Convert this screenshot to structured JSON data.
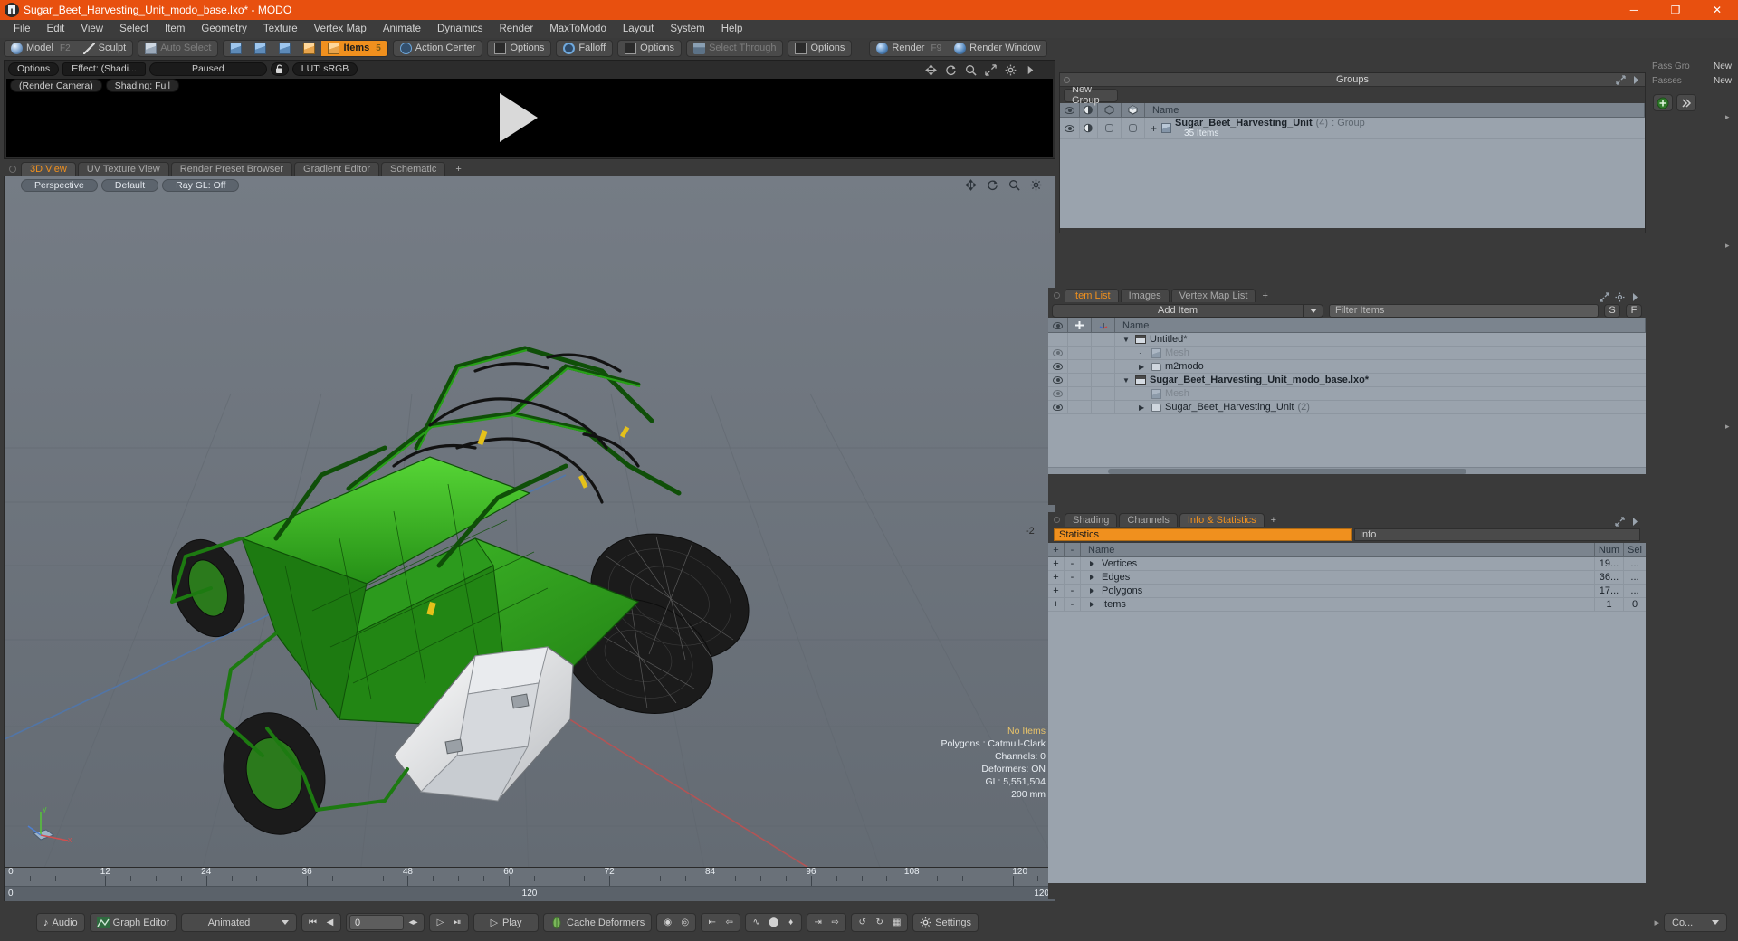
{
  "window": {
    "title": "Sugar_Beet_Harvesting_Unit_modo_base.lxo* - MODO",
    "minimize": "─",
    "maximize": "❐",
    "close": "✕"
  },
  "menubar": [
    "File",
    "Edit",
    "View",
    "Select",
    "Item",
    "Geometry",
    "Texture",
    "Vertex Map",
    "Animate",
    "Dynamics",
    "Render",
    "MaxToModo",
    "Layout",
    "System",
    "Help"
  ],
  "modebar": {
    "model": "Model",
    "model_key": "F2",
    "sculpt": "Sculpt",
    "auto_select": "Auto Select",
    "items": "Items",
    "items_key": "5",
    "action_center": "Action Center",
    "options1": "Options",
    "falloff": "Falloff",
    "options2": "Options",
    "select_through": "Select Through",
    "options3": "Options",
    "render": "Render",
    "render_key": "F9",
    "render_window": "Render Window"
  },
  "render_panel": {
    "options": "Options",
    "effect": "Effect: (Shadi...",
    "paused": "Paused",
    "lut": "LUT: sRGB",
    "render_camera": "(Render Camera)",
    "shading": "Shading: Full"
  },
  "viewport": {
    "tabs": [
      "3D View",
      "UV Texture View",
      "Render Preset Browser",
      "Gradient Editor",
      "Schematic"
    ],
    "active_tab": "3D View",
    "add_tab": "+",
    "projection": "Perspective",
    "shading_style": "Default",
    "raygl": "Ray GL: Off",
    "stats": {
      "no_items": "No Items",
      "polygons": "Polygons : Catmull-Clark",
      "channels": "Channels: 0",
      "deformers": "Deformers: ON",
      "gl": "GL: 5,551,504",
      "scale": "200 mm"
    },
    "axis": {
      "x": "x",
      "y": "y",
      "z": "z"
    },
    "depth_label": "-2"
  },
  "timeline": {
    "ticks": [
      {
        "label": "0",
        "pos": 0
      },
      {
        "label": "12",
        "pos": 9.6
      },
      {
        "label": "24",
        "pos": 19.2
      },
      {
        "label": "36",
        "pos": 28.8
      },
      {
        "label": "48",
        "pos": 38.4
      },
      {
        "label": "60",
        "pos": 48.0
      },
      {
        "label": "72",
        "pos": 57.6
      },
      {
        "label": "84",
        "pos": 67.2
      },
      {
        "label": "96",
        "pos": 76.8
      },
      {
        "label": "108",
        "pos": 86.4
      },
      {
        "label": "120",
        "pos": 96.0
      }
    ],
    "start": "0",
    "center": "120",
    "end": "120"
  },
  "groups_panel": {
    "title": "Groups",
    "new_group": "New Group",
    "columns": [
      "Name"
    ],
    "rows": [
      {
        "name": "Sugar_Beet_Harvesting_Unit",
        "count": "(4)",
        "type": ": Group",
        "sub": "35 Items",
        "expander": "+"
      }
    ]
  },
  "item_list_panel": {
    "tabs": [
      "Item List",
      "Images",
      "Vertex Map List"
    ],
    "active_tab": "Item List",
    "add_tab": "+",
    "add_item": "Add Item",
    "filter_placeholder": "Filter Items",
    "filter_value": "",
    "btn_s": "S",
    "btn_f": "F",
    "columns": [
      "Name"
    ],
    "rows": [
      {
        "name": "Untitled*",
        "indent": 0,
        "icon": "clapper-icon",
        "bold": false,
        "dim": false,
        "expander": "down"
      },
      {
        "name": "Mesh",
        "indent": 1,
        "icon": "mesh-icon",
        "bold": false,
        "dim": true,
        "expander": "dot"
      },
      {
        "name": "m2modo",
        "indent": 1,
        "icon": "folder-icon",
        "bold": false,
        "dim": false,
        "expander": "right"
      },
      {
        "name": "Sugar_Beet_Harvesting_Unit_modo_base.lxo*",
        "indent": 0,
        "icon": "clapper-icon",
        "bold": true,
        "dim": false,
        "expander": "down"
      },
      {
        "name": "Mesh",
        "indent": 1,
        "icon": "mesh-icon",
        "bold": false,
        "dim": true,
        "expander": "dot"
      },
      {
        "name": "Sugar_Beet_Harvesting_Unit",
        "count": "(2)",
        "indent": 1,
        "icon": "folder-icon",
        "bold": false,
        "dim": false,
        "expander": "right"
      }
    ]
  },
  "info_panel": {
    "tabs": [
      "Shading",
      "Channels",
      "Info & Statistics"
    ],
    "active_tab": "Info & Statistics",
    "add_tab": "+",
    "statistics_label": "Statistics",
    "info_label": "Info",
    "columns": {
      "plus": "+",
      "minus": "-",
      "name": "Name",
      "num": "Num",
      "sel": "Sel"
    },
    "rows": [
      {
        "plus": "+",
        "minus": "-",
        "name": "Vertices",
        "num": "19...",
        "sel": "..."
      },
      {
        "plus": "+",
        "minus": "-",
        "name": "Edges",
        "num": "36...",
        "sel": "..."
      },
      {
        "plus": "+",
        "minus": "-",
        "name": "Polygons",
        "num": "17...",
        "sel": "..."
      },
      {
        "plus": "+",
        "minus": "-",
        "name": "Items",
        "num": "1",
        "sel": "0"
      }
    ]
  },
  "rail": {
    "pass_group_label": "Pass Gro",
    "pass_group_new": "New",
    "passes_label": "Passes",
    "passes_new": "New",
    "co_label": "Co..."
  },
  "bottombar": {
    "audio": "Audio",
    "graph_editor": "Graph Editor",
    "animated": "Animated",
    "frame_value": "0",
    "play": "Play",
    "cache_deformers": "Cache Deformers",
    "settings": "Settings",
    "transport": {
      "first": "⏮",
      "prev": "◀",
      "next": "▶",
      "last": "⏭"
    }
  },
  "colors": {
    "accent": "#f0901e",
    "titlebar": "#e8500f",
    "panel_bg": "#3a3a3a",
    "list_bg": "#9aa3ad",
    "viewport_bg": "#6a7179",
    "model_green": "#2f9e1e"
  }
}
